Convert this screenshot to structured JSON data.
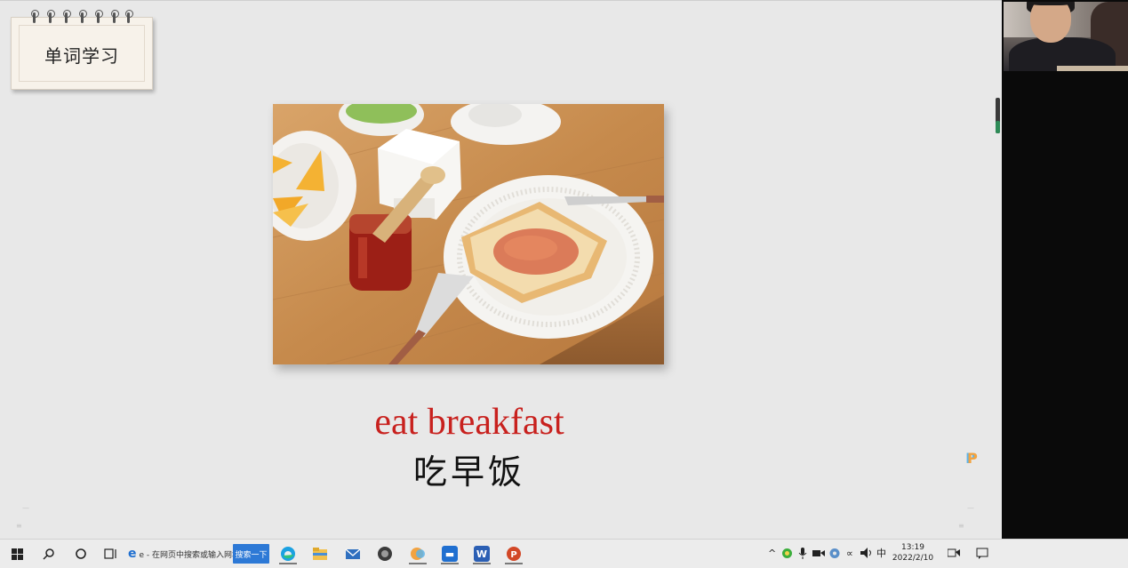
{
  "slide": {
    "title_card": "单词学习",
    "word_english": "eat breakfast",
    "word_chinese": "吃早饭",
    "word_color": "#c8211e",
    "photo_alt": "toast with jam breakfast photo"
  },
  "taskbar": {
    "start_icon": "windows-icon",
    "search_icon": "magnifier-icon",
    "cortana_icon": "circle-icon",
    "taskview_icon": "task-view-icon",
    "ie_tab_text": "e - 在网页中搜索或输入网址",
    "search_button_label": "搜索一下",
    "pinned_apps": [
      "edge-icon",
      "folder-icon",
      "mail-icon",
      "app-globe-icon",
      "wps-icon",
      "meeting-icon",
      "word-icon",
      "powerpoint-icon"
    ],
    "tray": {
      "clock_time": "13:19",
      "clock_date": "2022/2/10",
      "ime_label": "中"
    }
  },
  "colors": {
    "search_button": "#2d79d6",
    "slide_background": "#e8e8e8"
  }
}
